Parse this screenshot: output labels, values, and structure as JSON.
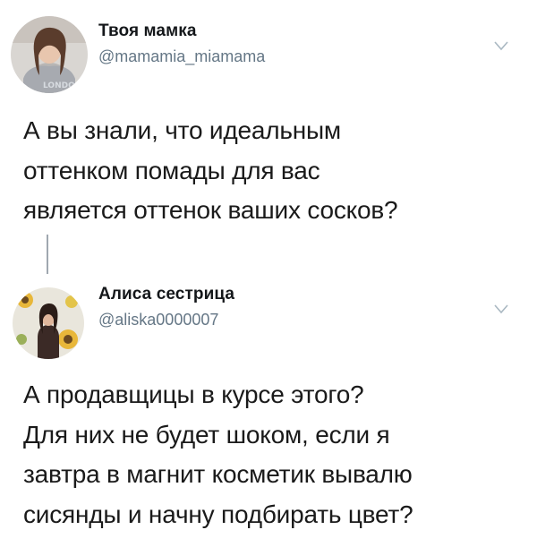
{
  "tweets": [
    {
      "author_name": "Твоя мамка",
      "author_handle": "@mamamia_miamama",
      "avatar_icon": "user-avatar-photo",
      "menu_icon": "chevron-down-icon",
      "text_lines": [
        "А вы знали, что идеальным",
        "оттенком помады для вас",
        "является оттенок ваших сосков?"
      ]
    },
    {
      "author_name": "Алиса сестрица",
      "author_handle": "@aliska0000007",
      "avatar_icon": "user-avatar-photo",
      "menu_icon": "chevron-down-icon",
      "text_lines": [
        "А продавщицы в курсе этого?",
        "Для них не будет шоком, если я",
        "завтра в магнит косметик вывалю",
        "сисянды и начну подбирать цвет?"
      ]
    }
  ],
  "colors": {
    "name": "#14171a",
    "handle": "#657786",
    "text": "#1a1a1a",
    "thread_line": "#a0a8b0",
    "chevron": "#aab8c2"
  }
}
